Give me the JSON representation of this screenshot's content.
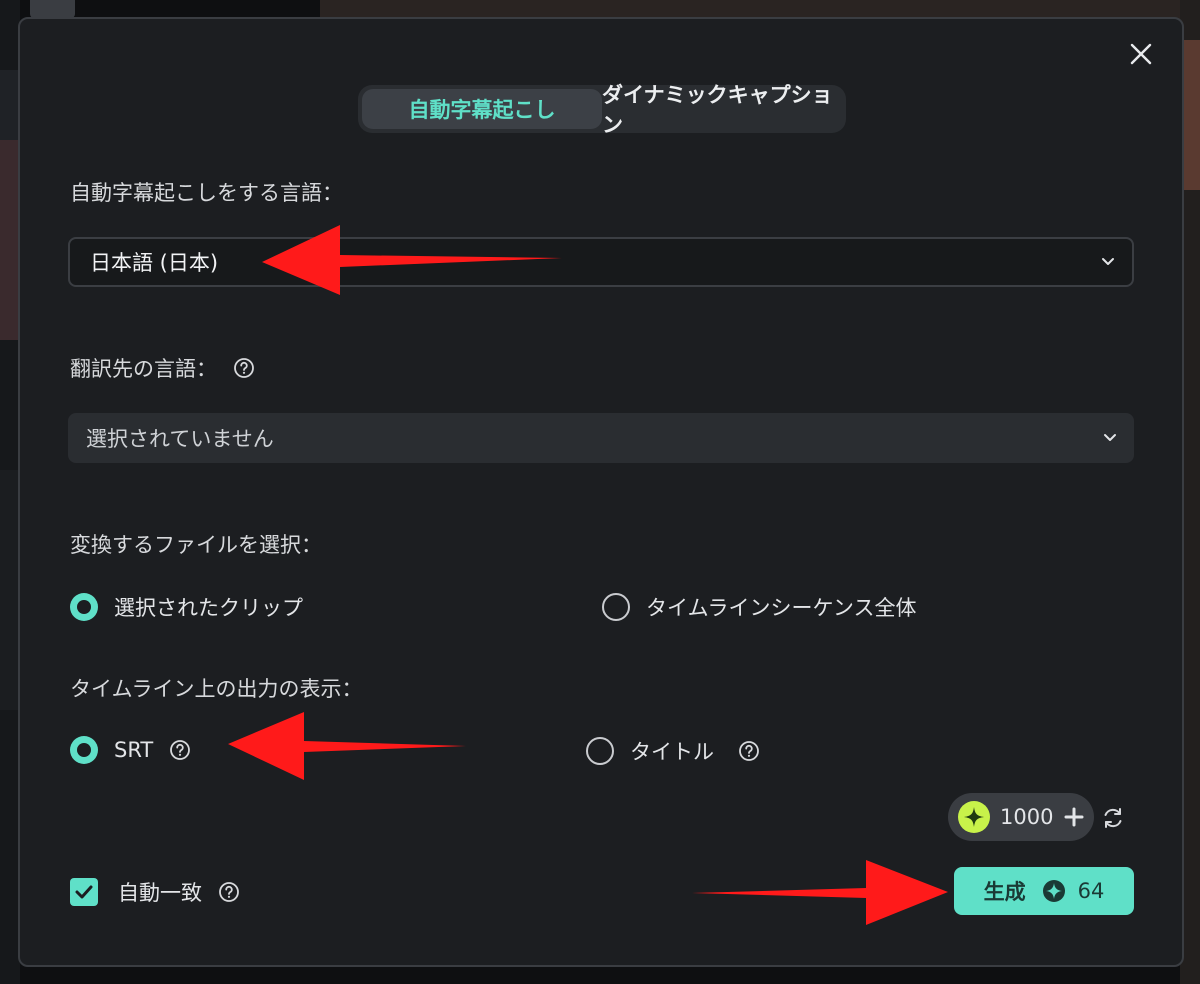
{
  "dialog": {
    "tabs": [
      {
        "label": "自動字幕起こし",
        "active": true
      },
      {
        "label": "ダイナミックキャプション",
        "active": false
      }
    ],
    "language": {
      "label": "自動字幕起こしをする言語：",
      "value": "日本語 (日本)"
    },
    "translation": {
      "label": "翻訳先の言語：",
      "value": "選択されていません"
    },
    "file_select": {
      "label": "変換するファイルを選択：",
      "options": [
        {
          "label": "選択されたクリップ",
          "checked": true
        },
        {
          "label": "タイムラインシーケンス全体",
          "checked": false
        }
      ]
    },
    "output": {
      "label": "タイムライン上の出力の表示：",
      "options": [
        {
          "label": "SRT",
          "checked": true
        },
        {
          "label": "タイトル",
          "checked": false
        }
      ]
    },
    "credits": {
      "amount": "1000"
    },
    "auto_match": {
      "label": "自動一致",
      "checked": true
    },
    "generate": {
      "label": "生成",
      "cost": "64"
    }
  },
  "colors": {
    "accent": "#5fe0c8",
    "annotation_arrow": "#ff1a1a",
    "credit_gem": "#c8f24a"
  }
}
